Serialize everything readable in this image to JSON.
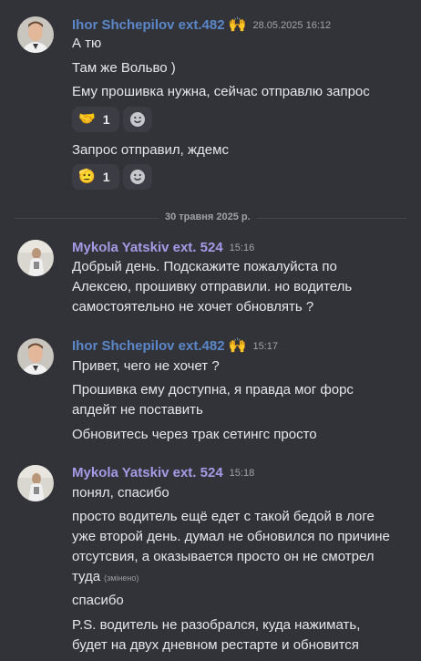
{
  "messages": [
    {
      "author": "Ihor Shchepilov ext.482",
      "role_icon": "wave-hands-icon",
      "timestamp": "28.05.2025 16:12",
      "lines": [
        "А тю",
        "Там же Вольво )",
        "Ему прошивка нужна, сейчас отправлю запрос"
      ],
      "reaction1": {
        "emoji": "🤝",
        "count": "1"
      },
      "line4": "Запрос отправил, ждемс",
      "reaction2": {
        "emoji": "🫡",
        "count": "1"
      }
    },
    {
      "author": "Mykola Yatskiv ext. 524",
      "timestamp": "15:16",
      "lines": [
        "Добрый день. Подскажите пожалуйста по",
        "Алексею, прошивку отправили. но водитель",
        "самостоятельно не хочет обновлять ?"
      ]
    },
    {
      "author": "Ihor Shchepilov ext.482",
      "timestamp": "15:17",
      "lines": [
        "Привет, чего не хочет ?",
        "Прошивка ему доступна, я правда мог форс",
        "апдейт не поставить",
        "Обновитесь через трак сетингс просто"
      ]
    },
    {
      "author": "Mykola Yatskiv ext. 524",
      "timestamp": "15:18",
      "lines": [
        "понял, спасибо",
        "просто водитель ещё едет с такой бедой в логе",
        "уже второй день. думал не обновился по причине",
        "отсутсвия, а оказывается просто он не смотрел",
        "туда",
        "спасибо",
        "P.S. водитель не разобрался, куда нажимать,",
        "будет на двух дневном рестарте и обновится"
      ],
      "edited": "(змінено)"
    }
  ],
  "divider": "30 травня 2025 р.",
  "colors": {
    "author_blue": "#5b87c8",
    "author_purple": "#a59ae6",
    "background": "#323339"
  }
}
